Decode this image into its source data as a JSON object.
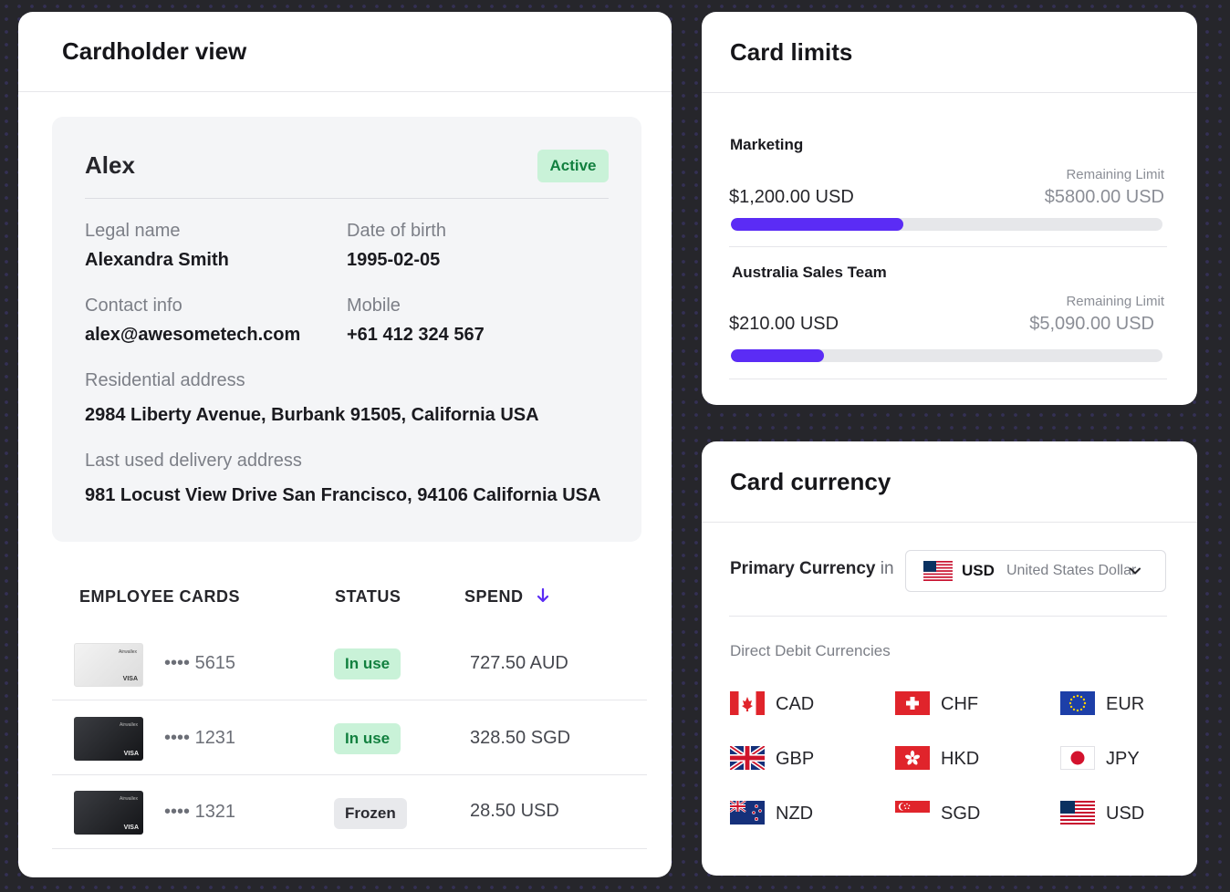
{
  "cardholder": {
    "title": "Cardholder view",
    "profile": {
      "name": "Alex",
      "status": "Active",
      "fields": {
        "legal_name_label": "Legal name",
        "legal_name": "Alexandra Smith",
        "dob_label": "Date of birth",
        "dob": "1995-02-05",
        "contact_label": "Contact info",
        "contact": "alex@awesometech.com",
        "mobile_label": "Mobile",
        "mobile": "+61 412 324 567",
        "residential_label": "Residential address",
        "residential": "2984 Liberty Avenue, Burbank 91505, California USA",
        "delivery_label": "Last used delivery address",
        "delivery": "981 Locust View Drive San Francisco, 94106 California USA"
      }
    },
    "table": {
      "headers": [
        "EMPLOYEE CARDS",
        "STATUS",
        "SPEND"
      ],
      "sort_icon": "arrow-down-icon",
      "rows": [
        {
          "card_style": "light",
          "brand": "VISA",
          "masked": "•••• 5615",
          "status": "In use",
          "spend": "727.50 AUD"
        },
        {
          "card_style": "dark",
          "brand": "VISA",
          "masked": "•••• 1231",
          "status": "In use",
          "spend": "328.50 SGD"
        },
        {
          "card_style": "dark",
          "brand": "VISA",
          "masked": "•••• 1321",
          "status": "Frozen",
          "spend": "28.50 USD"
        }
      ]
    }
  },
  "limits": {
    "title": "Card limits",
    "items": [
      {
        "name": "Marketing",
        "remaining_label": "Remaining Limit",
        "spent": "$1,200.00 USD",
        "remaining": "$5800.00 USD",
        "progress": 0.4
      },
      {
        "name": "Australia Sales Team",
        "remaining_label": "Remaining Limit",
        "spent": "$210.00 USD",
        "remaining": "$5,090.00 USD",
        "progress": 0.215
      }
    ]
  },
  "currency": {
    "title": "Card currency",
    "primary_label_bold": "Primary Currency",
    "primary_label_rest": " in",
    "selected": {
      "flag": "us-flag-icon",
      "code": "USD",
      "name": "United States Dollar"
    },
    "direct_debit_label": "Direct Debit Currencies",
    "list": [
      {
        "code": "CAD",
        "flag": "ca"
      },
      {
        "code": "CHF",
        "flag": "ch"
      },
      {
        "code": "EUR",
        "flag": "eu"
      },
      {
        "code": "GBP",
        "flag": "gb"
      },
      {
        "code": "HKD",
        "flag": "hk"
      },
      {
        "code": "JPY",
        "flag": "jp"
      },
      {
        "code": "NZD",
        "flag": "nz"
      },
      {
        "code": "SGD",
        "flag": "sg"
      },
      {
        "code": "USD",
        "flag": "us"
      }
    ]
  },
  "colors": {
    "accent": "#5b2cf5",
    "success_bg": "#c9f2d8",
    "success_text": "#12803f"
  }
}
